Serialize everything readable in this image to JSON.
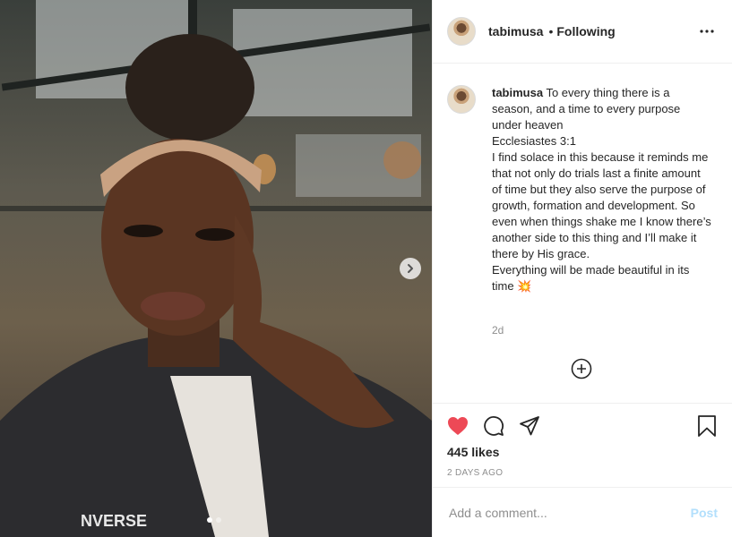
{
  "post": {
    "username": "tabimusa",
    "separator": "•",
    "follow_status": "Following",
    "caption_username": "tabimusa",
    "caption_text": " To every thing there is a season, and a time to every purpose under heaven\nEcclesiastes 3:1\nI find solace in this because it reminds me that not only do trials last a finite amount of time but they also serve the purpose of growth, formation and development. So even when things shake me I know there’s another side to this thing and I’ll make it there by His grace.\nEverything will be made beautiful in its time 💥",
    "time_ago": "2d",
    "likes": "445 likes",
    "date": "2 DAYS AGO",
    "comment_placeholder": "Add a comment...",
    "post_button": "Post",
    "carousel": {
      "count": 2,
      "active_index": 0
    }
  },
  "icons": {
    "more": "more-horizontal-icon",
    "like": "heart-filled-icon",
    "comment": "comment-icon",
    "share": "share-icon",
    "save": "bookmark-icon",
    "next": "chevron-right-icon",
    "load_more": "plus-circle-icon"
  },
  "colors": {
    "like_red": "#ed4956",
    "text": "#262626",
    "muted": "#8e8e8e",
    "post_disabled": "#b2dffc",
    "divider": "#efefef"
  }
}
